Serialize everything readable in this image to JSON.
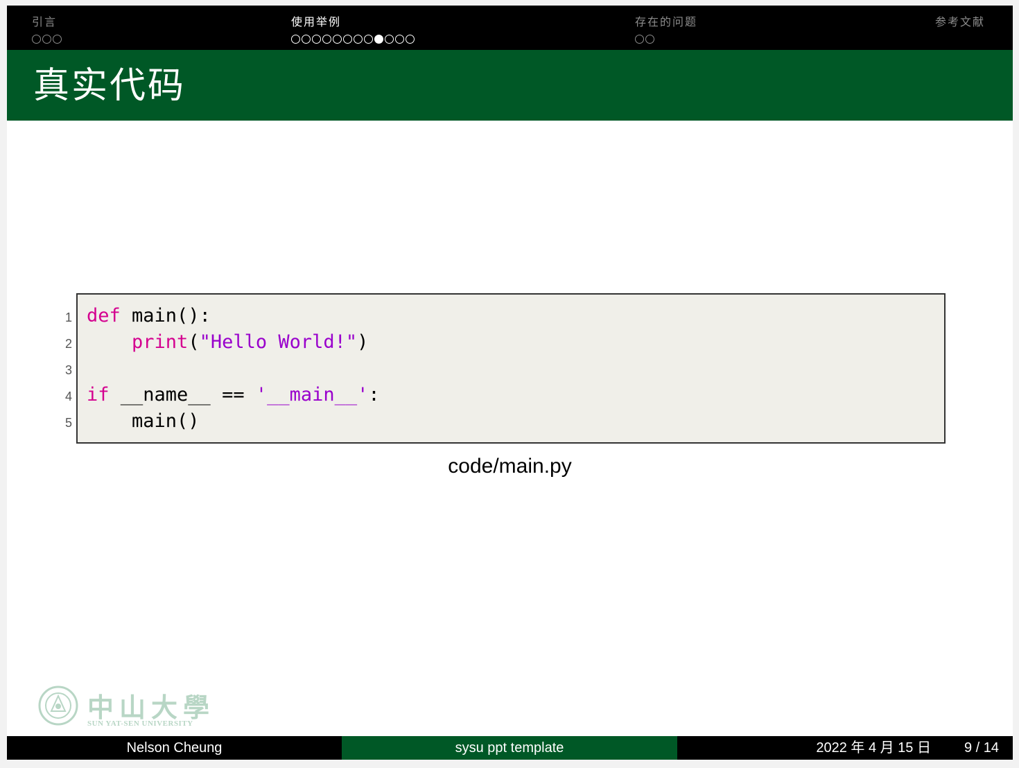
{
  "nav": {
    "sections": [
      {
        "title": "引言",
        "dots": 3,
        "current": -1
      },
      {
        "title": "使用举例",
        "dots": 12,
        "current": 8
      },
      {
        "title": "存在的问题",
        "dots": 2,
        "current": -1
      },
      {
        "title": "参考文献",
        "dots": 0,
        "current": -1
      }
    ]
  },
  "frame": {
    "title": "真实代码"
  },
  "code": {
    "lines": [
      {
        "number": "1",
        "tokens": [
          {
            "text": "def",
            "kind": "kw"
          },
          {
            "text": " main():",
            "kind": "plain"
          }
        ]
      },
      {
        "number": "2",
        "tokens": [
          {
            "text": "    ",
            "kind": "plain"
          },
          {
            "text": "print",
            "kind": "kw"
          },
          {
            "text": "(",
            "kind": "plain"
          },
          {
            "text": "\"Hello World!\"",
            "kind": "str"
          },
          {
            "text": ")",
            "kind": "plain"
          }
        ]
      },
      {
        "number": "3",
        "tokens": []
      },
      {
        "number": "4",
        "tokens": [
          {
            "text": "if",
            "kind": "kw"
          },
          {
            "text": " __name__ == ",
            "kind": "plain"
          },
          {
            "text": "'__main__'",
            "kind": "str"
          },
          {
            "text": ":",
            "kind": "plain"
          }
        ]
      },
      {
        "number": "5",
        "tokens": [
          {
            "text": "    main()",
            "kind": "plain"
          }
        ]
      }
    ],
    "caption": "code/main.py"
  },
  "logo": {
    "name": "中山大學",
    "subtitle": "SUN YAT-SEN UNIVERSITY"
  },
  "footer": {
    "author": "Nelson Cheung",
    "title": "sysu ppt template",
    "date": "2022 年 4 月 15 日",
    "page": "9 / 14"
  },
  "colors": {
    "header_band": "#005826",
    "nav_background": "#000000",
    "keyword": "#d4008f",
    "string": "#9900cc",
    "code_background": "#f0efe9",
    "logo_tint": "#b8d6c5"
  }
}
